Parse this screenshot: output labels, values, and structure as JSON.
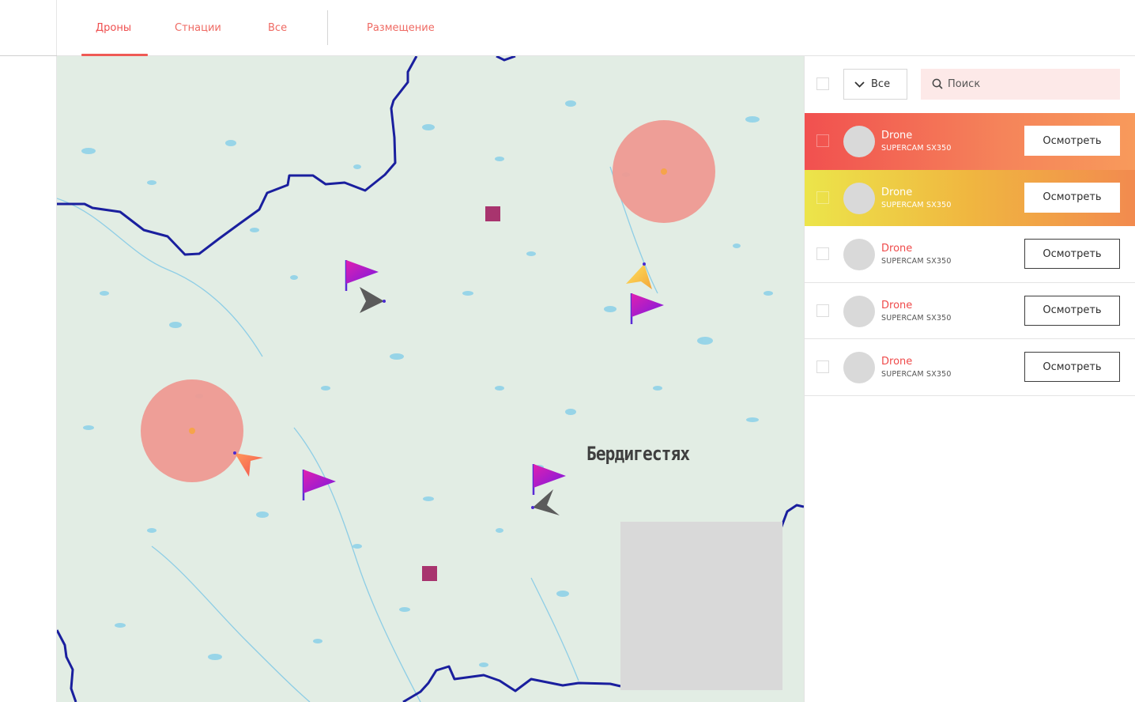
{
  "tabs": [
    {
      "label": "Дроны",
      "active": true
    },
    {
      "label": "Стнации",
      "active": false
    },
    {
      "label": "Все",
      "active": false
    },
    {
      "label": "Размещение",
      "active": false
    }
  ],
  "map": {
    "place_label": "Бердигестях",
    "markers": [
      "flag-icon",
      "drone-arrow-icon",
      "station-square-icon",
      "zone-circle"
    ]
  },
  "panel": {
    "filter_label": "Все",
    "search_placeholder": "Поиск",
    "items": [
      {
        "name": "Drone",
        "model": "SUPERCAM SX350",
        "action": "Осмотреть",
        "highlight": "red"
      },
      {
        "name": "Drone",
        "model": "SUPERCAM SX350",
        "action": "Осмотреть",
        "highlight": "yellow"
      },
      {
        "name": "Drone",
        "model": "SUPERCAM SX350",
        "action": "Осмотреть",
        "highlight": "none"
      },
      {
        "name": "Drone",
        "model": "SUPERCAM SX350",
        "action": "Осмотреть",
        "highlight": "none"
      },
      {
        "name": "Drone",
        "model": "SUPERCAM SX350",
        "action": "Осмотреть",
        "highlight": "none"
      }
    ]
  },
  "colors": {
    "accent": "#ef5a55",
    "border_blue": "#1a1f9e",
    "map_bg": "#e2ede4",
    "water": "#72c8e8",
    "zone": "#ee9a92",
    "station": "#a8346e"
  }
}
